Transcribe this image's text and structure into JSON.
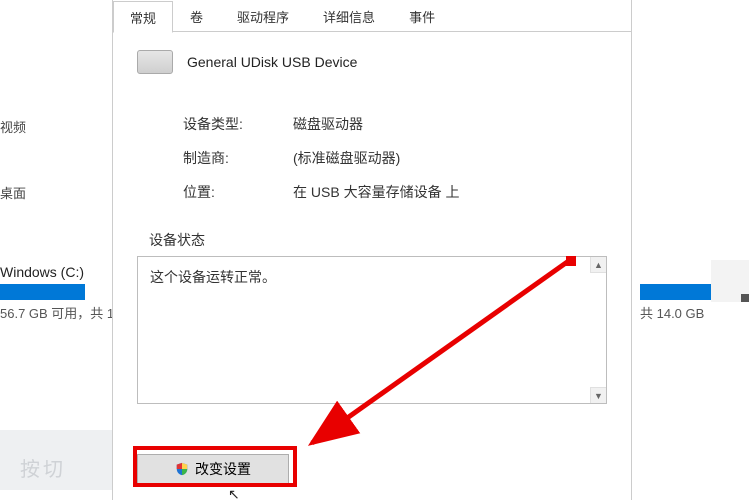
{
  "background": {
    "video_label": "视频",
    "desktop_label": "桌面",
    "drive_c_label": "Windows (C:)",
    "drive_c_usage": "56.7 GB 可用，共 1",
    "right_usage": "共 14.0 GB",
    "switch_text": "按切"
  },
  "dialog": {
    "tabs": {
      "general": "常规",
      "volumes": "卷",
      "driver": "驱动程序",
      "details": "详细信息",
      "events": "事件"
    },
    "device_name": "General UDisk USB Device",
    "properties": {
      "type_label": "设备类型:",
      "type_value": "磁盘驱动器",
      "manufacturer_label": "制造商:",
      "manufacturer_value": "(标准磁盘驱动器)",
      "location_label": "位置:",
      "location_value": "在 USB 大容量存储设备 上"
    },
    "status_label": "设备状态",
    "status_text": "这个设备运转正常。",
    "change_settings_button": "改变设置"
  }
}
